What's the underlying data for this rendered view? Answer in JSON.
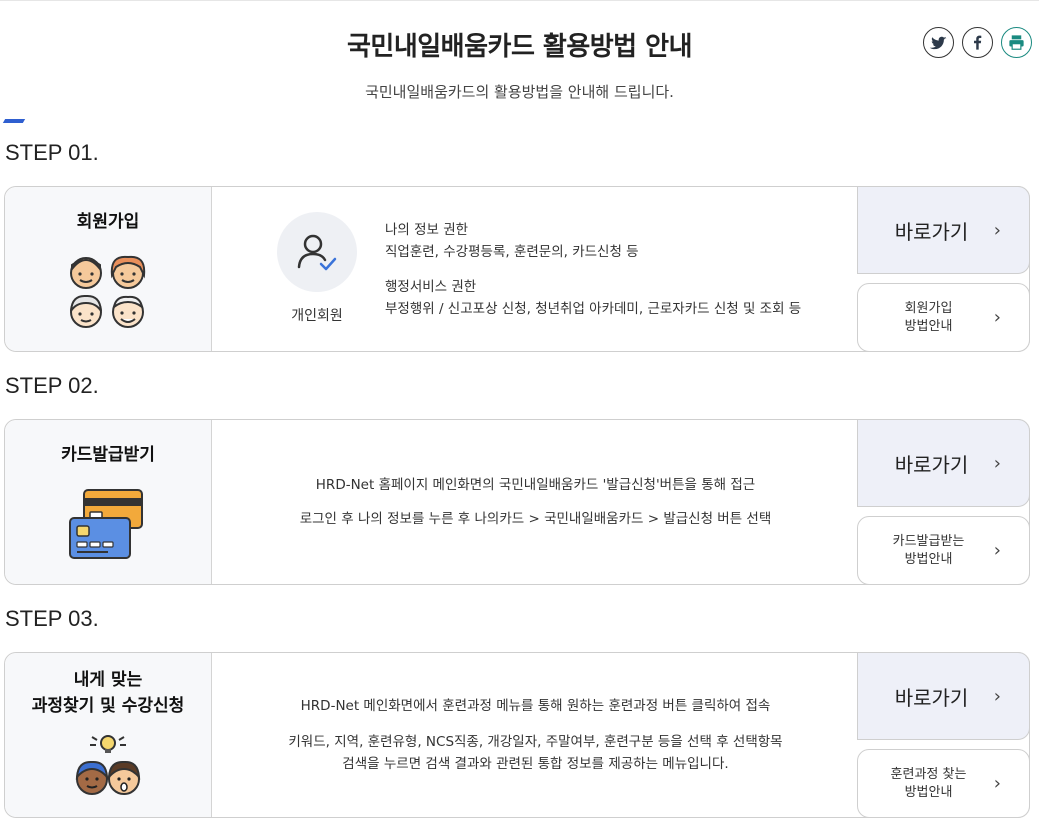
{
  "header": {
    "title": "국민내일배움카드 활용방법 안내",
    "subtitle": "국민내일배움카드의 활용방법을 안내해 드립니다."
  },
  "share": {
    "twitter_icon": "twitter-icon",
    "facebook_icon": "facebook-icon",
    "print_icon": "print-icon",
    "print_color": "#1a8a80"
  },
  "steps": [
    {
      "label": "STEP 01.",
      "name": "회원가입",
      "illustration": "four-people-faces-icon",
      "member": {
        "label": "개인회원",
        "icon": "user-check-icon"
      },
      "permissions": [
        {
          "title": "나의 정보 권한",
          "desc": "직업훈련, 수강평등록, 훈련문의, 카드신청 등"
        },
        {
          "title": "행정서비스 권한",
          "desc": "부정행위 / 신고포상 신청, 청년취업 아카데미, 근로자카드 신청 및 조회 등"
        }
      ],
      "go_label": "바로가기",
      "how_label": "회원가입\n방법안내"
    },
    {
      "label": "STEP 02.",
      "name": "카드발급받기",
      "illustration": "credit-cards-icon",
      "lines": [
        "HRD-Net 홈페이지 메인화면의 국민내일배움카드 '발급신청'버튼을 통해 접근",
        "로그인 후 나의 정보를 누른 후 나의카드 > 국민내일배움카드 > 발급신청 버튼 선택"
      ],
      "go_label": "바로가기",
      "how_label": "카드발급받는\n방법안내"
    },
    {
      "label": "STEP 03.",
      "name_line1": "내게 맞는",
      "name_line2": "과정찾기 및 수강신청",
      "illustration": "idea-people-icon",
      "lines": [
        "HRD-Net 메인화면에서 훈련과정 메뉴를 통해 원하는 훈련과정 버튼 클릭하여 접속",
        "키워드, 지역, 훈련유형, NCS직종, 개강일자, 주말여부, 훈련구분 등을 선택 후 선택항목",
        "검색을 누르면 검색 결과와 관련된 통합 정보를 제공하는 메뉴입니다."
      ],
      "go_label": "바로가기",
      "how_label": "훈련과정 찾는\n방법안내"
    }
  ],
  "colors": {
    "accent": "#2f5fd0",
    "go_button_bg": "#eef0f8",
    "left_panel_bg": "#f7f8fa"
  }
}
